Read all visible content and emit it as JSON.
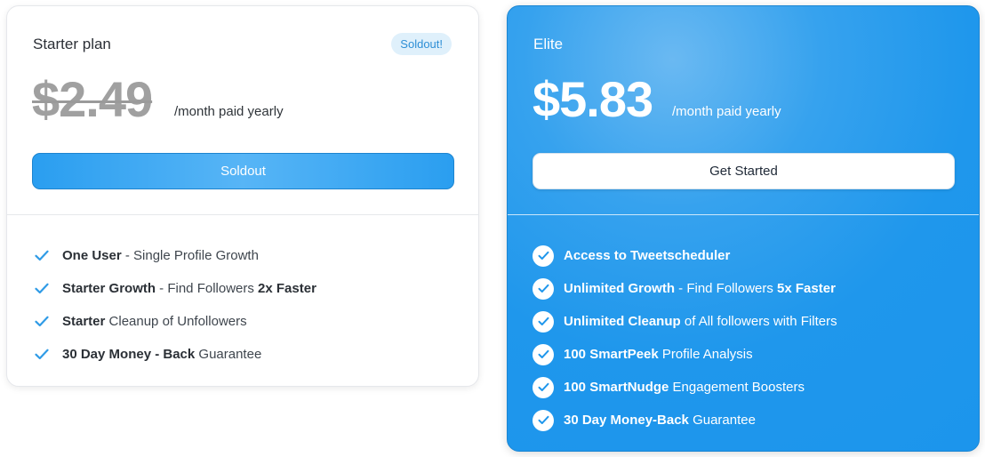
{
  "starter": {
    "name": "Starter plan",
    "badge": "Soldout!",
    "price": "$2.49",
    "period": "/month paid yearly",
    "cta": "Soldout",
    "features": [
      {
        "bold": "One User",
        "rest": " - Single Profile Growth",
        "bold2": "",
        "rest2": ""
      },
      {
        "bold": "Starter Growth",
        "rest": " - Find Followers ",
        "bold2": "2x Faster",
        "rest2": ""
      },
      {
        "bold": "Starter",
        "rest": " Cleanup of Unfollowers",
        "bold2": "",
        "rest2": ""
      },
      {
        "bold": "30 Day Money - Back",
        "rest": " Guarantee",
        "bold2": "",
        "rest2": ""
      }
    ]
  },
  "elite": {
    "name": "Elite",
    "price": "$5.83",
    "period": "/month paid yearly",
    "cta": "Get Started",
    "features": [
      {
        "bold": "Access to Tweetscheduler",
        "rest": "",
        "bold2": "",
        "rest2": ""
      },
      {
        "bold": "Unlimited Growth",
        "rest": " - Find Followers ",
        "bold2": "5x Faster",
        "rest2": ""
      },
      {
        "bold": "Unlimited Cleanup",
        "rest": " of All followers with Filters",
        "bold2": "",
        "rest2": ""
      },
      {
        "bold": "100 SmartPeek",
        "rest": " Profile Analysis",
        "bold2": "",
        "rest2": ""
      },
      {
        "bold": "100 SmartNudge",
        "rest": " Engagement Boosters",
        "bold2": "",
        "rest2": ""
      },
      {
        "bold": "30 Day Money-Back",
        "rest": " Guarantee",
        "bold2": "",
        "rest2": ""
      }
    ]
  },
  "icons": {
    "feature_check": "check-icon"
  },
  "colors": {
    "accent": "#1e96ec",
    "badge_bg": "#dff0fb",
    "badge_text": "#2e8fd6",
    "check": "#2f9be6"
  }
}
